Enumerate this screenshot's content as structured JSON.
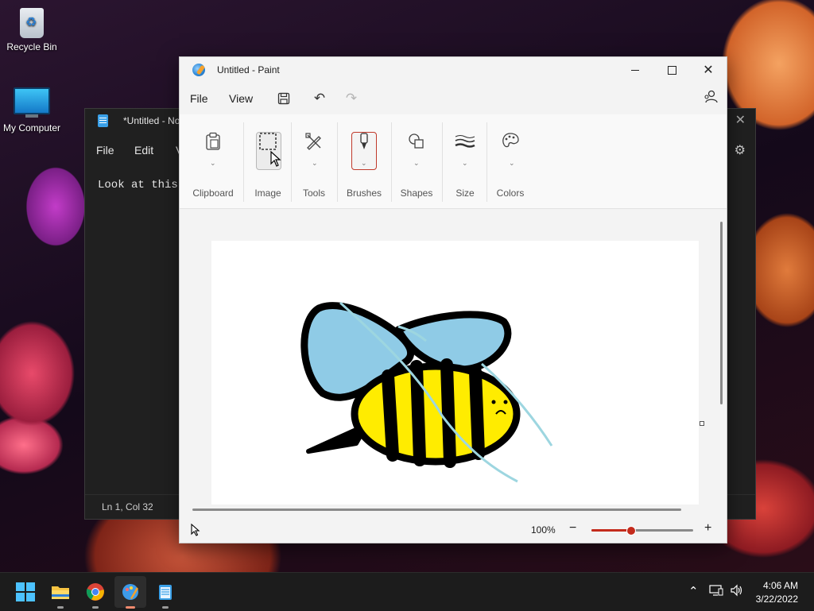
{
  "desktop": {
    "icons": [
      {
        "label": "Recycle Bin",
        "icon": "recycle-bin-icon"
      },
      {
        "label": "My Computer",
        "icon": "computer-icon"
      }
    ]
  },
  "notepad": {
    "title": "*Untitled - No",
    "menu": {
      "file": "File",
      "edit": "Edit",
      "view": "V"
    },
    "text": "Look at this.",
    "status": "Ln 1, Col 32"
  },
  "paint": {
    "title": "Untitled - Paint",
    "menu": {
      "file": "File",
      "view": "View"
    },
    "ribbon": {
      "clipboard": "Clipboard",
      "image": "Image",
      "tools": "Tools",
      "brushes": "Brushes",
      "shapes": "Shapes",
      "size": "Size",
      "colors": "Colors"
    },
    "zoom": {
      "label": "100%",
      "level_fraction": 0.38
    },
    "colors": {
      "accent": "#c42b1c",
      "wing": "#8fcbe6",
      "stripe": "#ffec00",
      "line": "#9dd6e0"
    }
  },
  "taskbar": {
    "apps": [
      "start-icon",
      "file-explorer-icon",
      "chrome-icon",
      "paint-icon",
      "notepad-icon"
    ],
    "time": "4:06 AM",
    "date": "3/22/2022"
  }
}
